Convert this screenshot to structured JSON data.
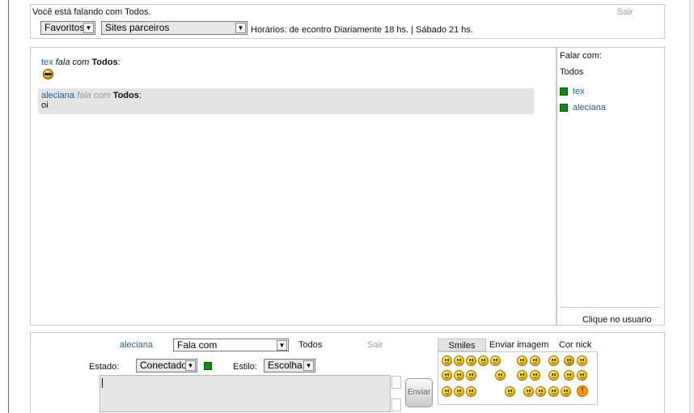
{
  "header": {
    "status_text": "Você está falando com Todos.",
    "exit_label": "Sair",
    "favorites_select": "Favoritos",
    "sites_select": "Sites parceiros",
    "schedule_text": "Horários: de econtro Diariamente 18 hs. | Sábado 21 hs."
  },
  "messages": [
    {
      "user": "tex",
      "verb": "fala com",
      "target": "Todos",
      "content_type": "emoticon",
      "icon": "sunglasses-smiley-icon"
    },
    {
      "user": "aleciana",
      "verb": "fala com",
      "target": "Todos",
      "text": "oi",
      "highlighted": true
    }
  ],
  "users_panel": {
    "title": "Falar com:",
    "all_label": "Todos",
    "users": [
      {
        "name": "tex",
        "status_color": "#118a11"
      },
      {
        "name": "aleciana",
        "status_color": "#118a11"
      }
    ],
    "footer_label": "Clique no usuario"
  },
  "composer": {
    "nickname": "aleciana",
    "mode_select": "Fala com",
    "target": "Todos",
    "exit_label": "Sair",
    "state_label": "Estado:",
    "state_select": "Conectado",
    "state_color": "#118a11",
    "style_label": "Estilo:",
    "style_select": "Escolha",
    "send_label": "Enviar",
    "message_value": ""
  },
  "emoticon_tabs": {
    "tabs": [
      "Smiles",
      "Enviar imagem",
      "Cor nick"
    ],
    "active": "Smiles"
  },
  "colors": {
    "link": "#1b5c99",
    "highlight_row": "#e4e4e4",
    "status_green": "#118a11"
  }
}
